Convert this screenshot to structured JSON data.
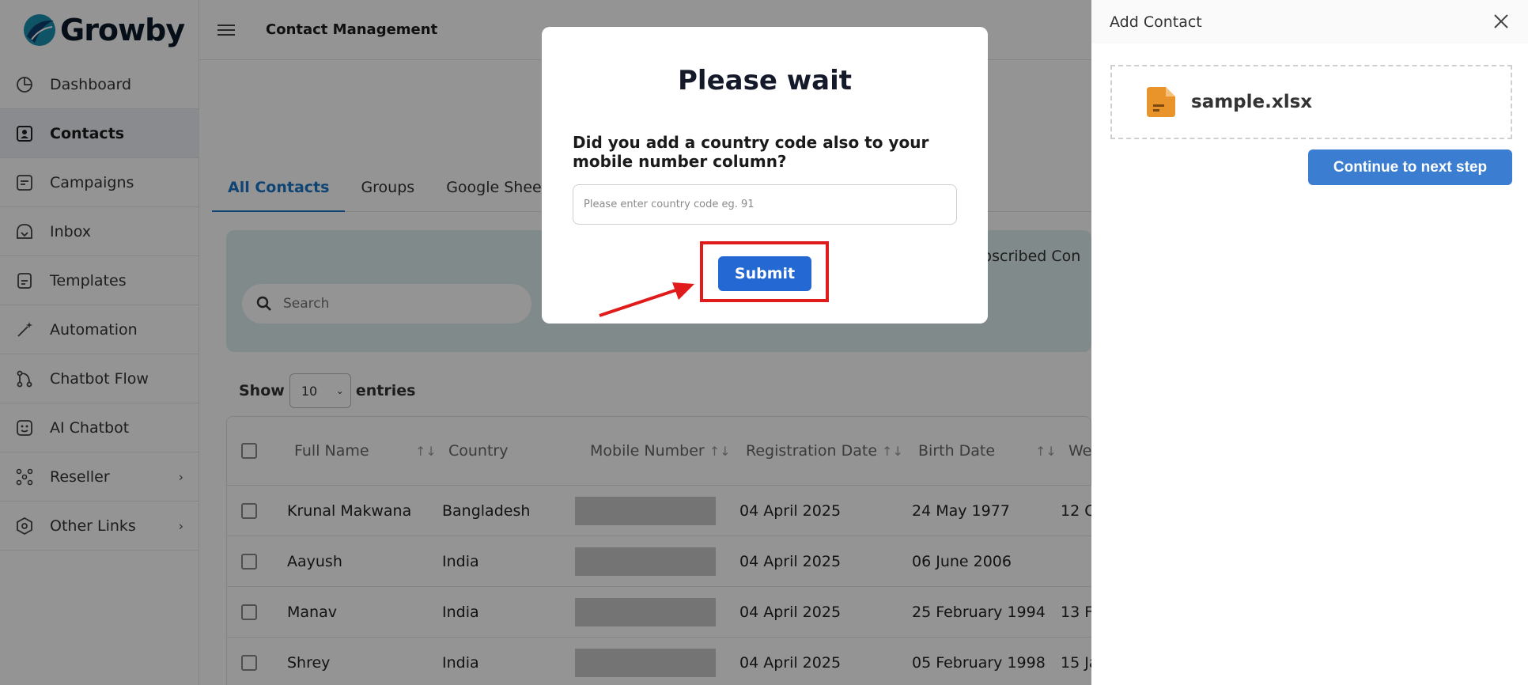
{
  "brand": {
    "name": "Growby"
  },
  "sidebar": {
    "items": [
      {
        "label": "Dashboard",
        "icon": "pie-chart-icon",
        "active": false,
        "chevron": false
      },
      {
        "label": "Contacts",
        "icon": "contact-card-icon",
        "active": true,
        "chevron": false
      },
      {
        "label": "Campaigns",
        "icon": "campaign-icon",
        "active": false,
        "chevron": false
      },
      {
        "label": "Inbox",
        "icon": "inbox-icon",
        "active": false,
        "chevron": false
      },
      {
        "label": "Templates",
        "icon": "template-icon",
        "active": false,
        "chevron": false
      },
      {
        "label": "Automation",
        "icon": "magic-wand-icon",
        "active": false,
        "chevron": false
      },
      {
        "label": "Chatbot Flow",
        "icon": "flow-icon",
        "active": false,
        "chevron": false
      },
      {
        "label": "AI Chatbot",
        "icon": "bot-face-icon",
        "active": false,
        "chevron": false
      },
      {
        "label": "Reseller",
        "icon": "network-icon",
        "active": false,
        "chevron": true
      },
      {
        "label": "Other Links",
        "icon": "hexagon-icon",
        "active": false,
        "chevron": true
      }
    ]
  },
  "header": {
    "title": "Contact Management"
  },
  "tabs": [
    "All Contacts",
    "Groups",
    "Google Sheet"
  ],
  "filter": {
    "search_placeholder": "Search",
    "partial_label": "ubscribed Con"
  },
  "entries": {
    "show": "Show",
    "value": "10",
    "suffix": "entries"
  },
  "table": {
    "headers": [
      "Full Name",
      "Country",
      "Mobile Number",
      "Registration Date",
      "Birth Date",
      "We"
    ],
    "rows": [
      {
        "name": "Krunal Makwana",
        "country": "Bangladesh",
        "reg": "04 April 2025",
        "birth": "24 May 1977",
        "extra": "12 O"
      },
      {
        "name": "Aayush",
        "country": "India",
        "reg": "04 April 2025",
        "birth": "06 June 2006",
        "extra": ""
      },
      {
        "name": "Manav",
        "country": "India",
        "reg": "04 April 2025",
        "birth": "25 February 1994",
        "extra": "13 Fe"
      },
      {
        "name": "Shrey",
        "country": "India",
        "reg": "04 April 2025",
        "birth": "05 February 1998",
        "extra": "15 Ja"
      }
    ]
  },
  "drawer": {
    "title": "Add Contact",
    "file_name": "sample.xlsx",
    "continue_label": "Continue to next step"
  },
  "modal": {
    "title": "Please wait",
    "question": "Did you add a country code also to your mobile number column?",
    "input_placeholder": "Please enter country code eg. 91",
    "submit_label": "Submit"
  },
  "colors": {
    "accent": "#1b76c9",
    "submit": "#2468d3",
    "highlight": "#e01b1b",
    "file_icon": "#e8942a"
  }
}
